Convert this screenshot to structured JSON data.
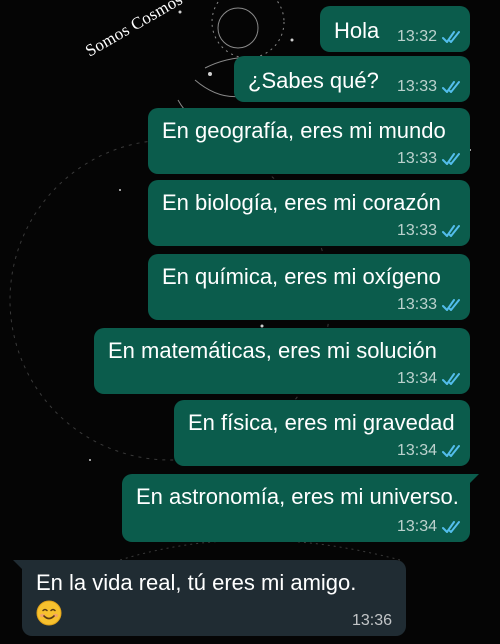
{
  "watermark": "Somos Cosmos",
  "theme": {
    "outgoing_bubble": "#0b5c4c",
    "incoming_bubble": "#202c33",
    "read_tick": "#53bdeb",
    "background": "#050505"
  },
  "messages": [
    {
      "direction": "outgoing",
      "text": "Hola",
      "time": "13:32",
      "status": "read"
    },
    {
      "direction": "outgoing",
      "text": "¿Sabes qué?",
      "time": "13:33",
      "status": "read"
    },
    {
      "direction": "outgoing",
      "text": "En geografía, eres mi mundo",
      "time": "13:33",
      "status": "read"
    },
    {
      "direction": "outgoing",
      "text": "En biología, eres mi corazón",
      "time": "13:33",
      "status": "read"
    },
    {
      "direction": "outgoing",
      "text": "En química, eres mi oxígeno",
      "time": "13:33",
      "status": "read"
    },
    {
      "direction": "outgoing",
      "text": "En matemáticas, eres mi solución",
      "time": "13:34",
      "status": "read"
    },
    {
      "direction": "outgoing",
      "text": "En física, eres mi gravedad",
      "time": "13:34",
      "status": "read"
    },
    {
      "direction": "outgoing",
      "text": "En astronomía, eres mi universo.",
      "time": "13:34",
      "status": "read"
    },
    {
      "direction": "incoming",
      "text": "En la vida real, tú eres mi amigo.",
      "emoji": "smiling-face-emoji",
      "time": "13:36"
    }
  ]
}
